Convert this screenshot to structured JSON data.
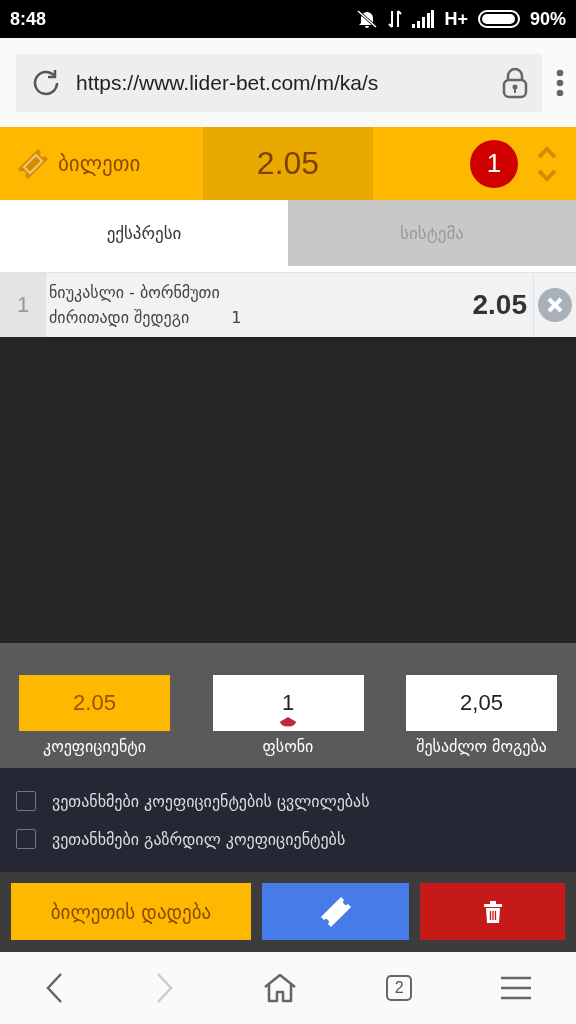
{
  "status_bar": {
    "time": "8:48",
    "network": "H+",
    "battery": "90%"
  },
  "browser": {
    "url": "https://www.lider-bet.com/m/ka/s",
    "tab_count": "2",
    "forward_disabled": true
  },
  "header": {
    "title": "ბილეთი",
    "total_odds": "2.05",
    "count": "1"
  },
  "tabs": [
    {
      "label": "ექსპრესი",
      "selected": true
    },
    {
      "label": "სისტემა",
      "selected": false
    }
  ],
  "bets": [
    {
      "index": "1",
      "match": "ნიუკასლი - ბორნმუთი",
      "market": "ძირითადი შედეგი",
      "pick": "1",
      "odds": "2.05"
    }
  ],
  "summary": [
    {
      "kind": "readonly",
      "value": "2.05",
      "label": "კოეფიციენტი"
    },
    {
      "kind": "input",
      "value": "1",
      "label": "ფსონი"
    },
    {
      "kind": "output",
      "value": "2,05",
      "label": "შესაძლო მოგება"
    }
  ],
  "options": [
    {
      "label": "ვეთანხმები კოეფიციენტების ცვლილებას",
      "checked": false
    },
    {
      "label": "ვეთანხმები გაზრდილ კოეფიციენტებს",
      "checked": false
    }
  ],
  "place_button": "ბილეთის დადება"
}
